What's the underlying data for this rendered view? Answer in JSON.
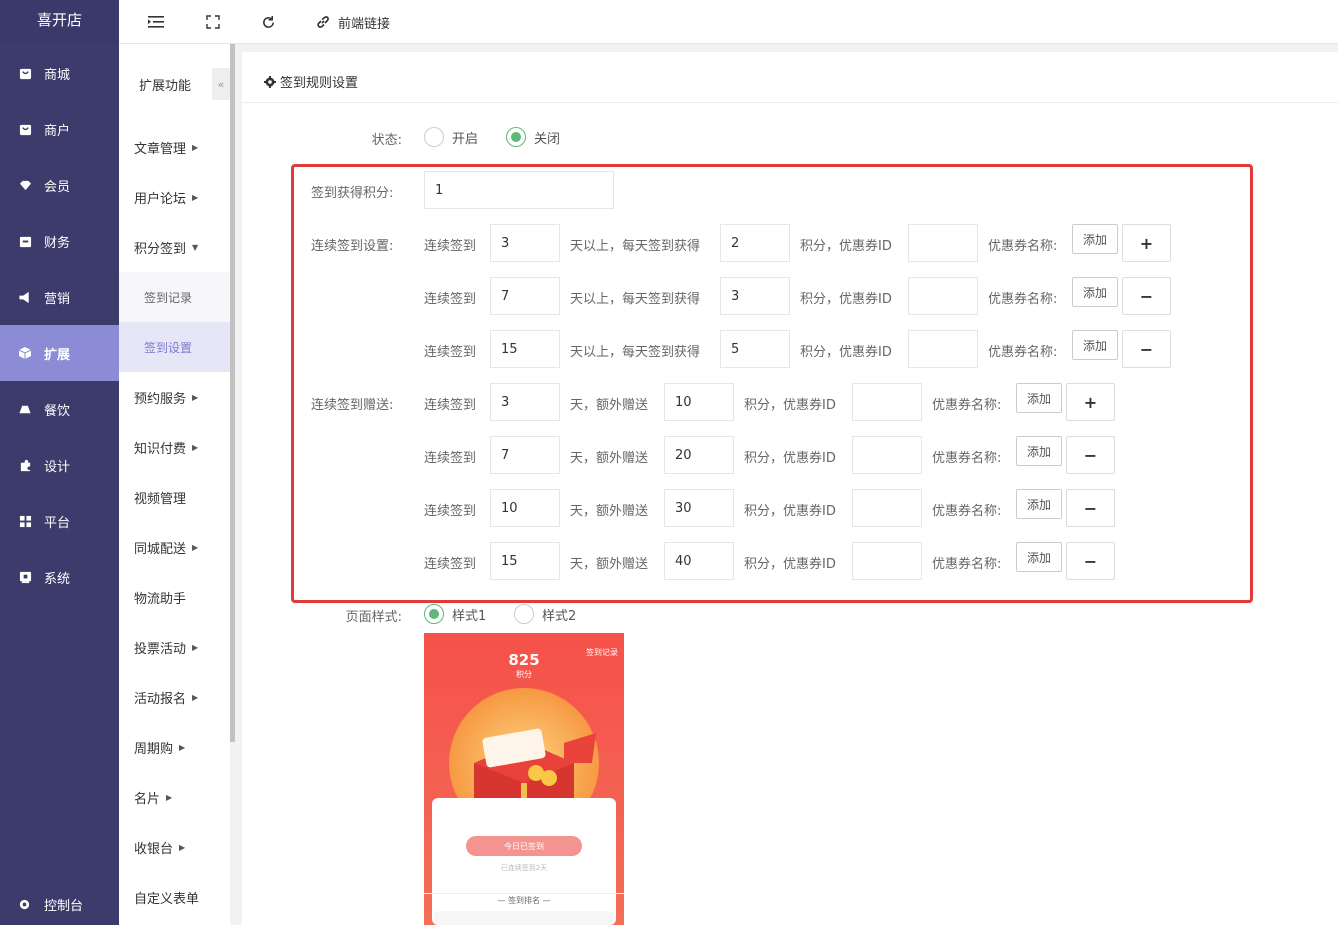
{
  "brand": "喜开店",
  "sidebar": {
    "items": [
      {
        "label": "商城",
        "icon": "shop-icon"
      },
      {
        "label": "商户",
        "icon": "merchant-icon"
      },
      {
        "label": "会员",
        "icon": "member-icon"
      },
      {
        "label": "财务",
        "icon": "finance-icon"
      },
      {
        "label": "营销",
        "icon": "megaphone-icon"
      },
      {
        "label": "扩展",
        "icon": "cube-icon",
        "active": true
      },
      {
        "label": "餐饮",
        "icon": "dining-icon"
      },
      {
        "label": "设计",
        "icon": "puzzle-icon"
      },
      {
        "label": "平台",
        "icon": "grid-icon"
      },
      {
        "label": "系统",
        "icon": "system-icon"
      }
    ],
    "bottom": "控制台"
  },
  "topbar": {
    "frontend_link": "前端链接"
  },
  "subsidebar": {
    "title": "扩展功能",
    "collapse_glyph": "«",
    "items": [
      {
        "label": "文章管理"
      },
      {
        "label": "用户论坛"
      },
      {
        "label": "积分签到"
      },
      {
        "label": "签到记录"
      },
      {
        "label": "签到设置"
      },
      {
        "label": "预约服务"
      },
      {
        "label": "知识付费"
      },
      {
        "label": "视频管理"
      },
      {
        "label": "同城配送"
      },
      {
        "label": "物流助手"
      },
      {
        "label": "投票活动"
      },
      {
        "label": "活动报名"
      },
      {
        "label": "周期购"
      },
      {
        "label": "名片"
      },
      {
        "label": "收银台"
      },
      {
        "label": "自定义表单"
      }
    ]
  },
  "form": {
    "title": "签到规则设置",
    "status_label": "状态:",
    "status_on": "开启",
    "status_off": "关闭",
    "points_label": "签到获得积分:",
    "points_value": "1",
    "continuous_label": "连续签到设置:",
    "gift_label": "连续签到赠送:",
    "t_continuous": "连续签到",
    "t_days_each": "天以上，每天签到获得",
    "t_points_coupon": "积分，优惠券ID",
    "t_coupon_name": "优惠券名称:",
    "t_days_extra": "天，额外赠送",
    "add_label": "添加",
    "plus": "+",
    "minus": "−",
    "continuous_rows": [
      {
        "days": "3",
        "points": "2"
      },
      {
        "days": "7",
        "points": "3"
      },
      {
        "days": "15",
        "points": "5"
      }
    ],
    "gift_rows": [
      {
        "days": "3",
        "points": "10"
      },
      {
        "days": "7",
        "points": "20"
      },
      {
        "days": "10",
        "points": "30"
      },
      {
        "days": "15",
        "points": "40"
      }
    ],
    "style_label": "页面样式:",
    "style1": "样式1",
    "style2": "样式2"
  },
  "preview": {
    "points": "825",
    "points_unit": "积分",
    "record_link": "签到记录",
    "signed_button": "今日已签到",
    "signed_days": "已连续签到2天",
    "rank_title": "— 签到排名 —"
  },
  "colors": {
    "sidebar": "#3c3b6b",
    "active": "#8b8bd6",
    "accent": "#5fb878",
    "highlight": "#e03a3a"
  }
}
